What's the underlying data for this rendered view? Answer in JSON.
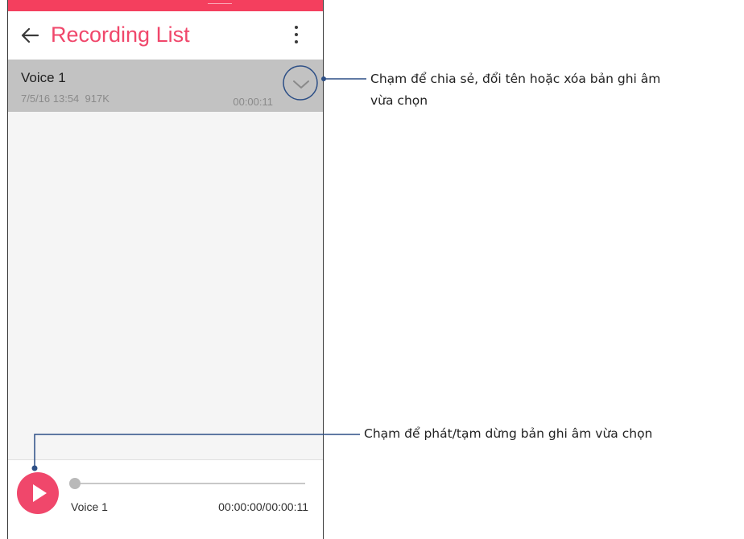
{
  "app": {
    "title": "Recording List",
    "accent_color": "#f0476b",
    "status_bar_color": "#f43f5e",
    "icons": {
      "back": "arrow-left-icon",
      "menu": "more-vertical-icon"
    }
  },
  "recordings": [
    {
      "name": "Voice 1",
      "date": "7/5/16 13:54",
      "size": "917K",
      "duration": "00:00:11",
      "selected": true,
      "expand_icon": "chevron-down-icon"
    }
  ],
  "player": {
    "track_name": "Voice 1",
    "time": "00:00:00/00:00:11",
    "progress": 0,
    "play_icon": "play-icon"
  },
  "callouts": [
    {
      "line1": "Chạm để chia sẻ, đổi tên hoặc xóa bản ghi âm",
      "line2": "vừa chọn"
    },
    {
      "line1": "Chạm để phát/tạm dừng bản ghi âm vừa chọn"
    }
  ]
}
